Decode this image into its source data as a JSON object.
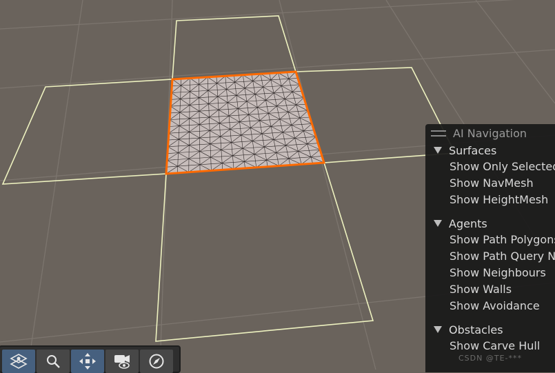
{
  "panel": {
    "title": "AI Navigation",
    "sections": [
      {
        "title": "Surfaces",
        "items": [
          "Show Only Selected",
          "Show NavMesh",
          "Show HeightMesh"
        ]
      },
      {
        "title": "Agents",
        "items": [
          "Show Path Polygons",
          "Show Path Query Nodes",
          "Show Neighbours",
          "Show Walls",
          "Show Avoidance"
        ]
      },
      {
        "title": "Obstacles",
        "items": [
          "Show Carve Hull"
        ]
      }
    ]
  },
  "toolbar": {
    "buttons": [
      {
        "icon": "navmesh-icon",
        "active": true
      },
      {
        "icon": "search-icon",
        "active": false
      },
      {
        "icon": "move-icon",
        "active": true
      },
      {
        "icon": "camera-visibility-icon",
        "active": false
      },
      {
        "icon": "compass-icon",
        "active": false
      }
    ]
  },
  "watermark": "CSDN @TE-***",
  "colors": {
    "background": "#6a635c",
    "selected_outline": "#ff6a00",
    "tile_outline": "#eef2c0",
    "navmesh_fill": "#c7bdbb"
  }
}
